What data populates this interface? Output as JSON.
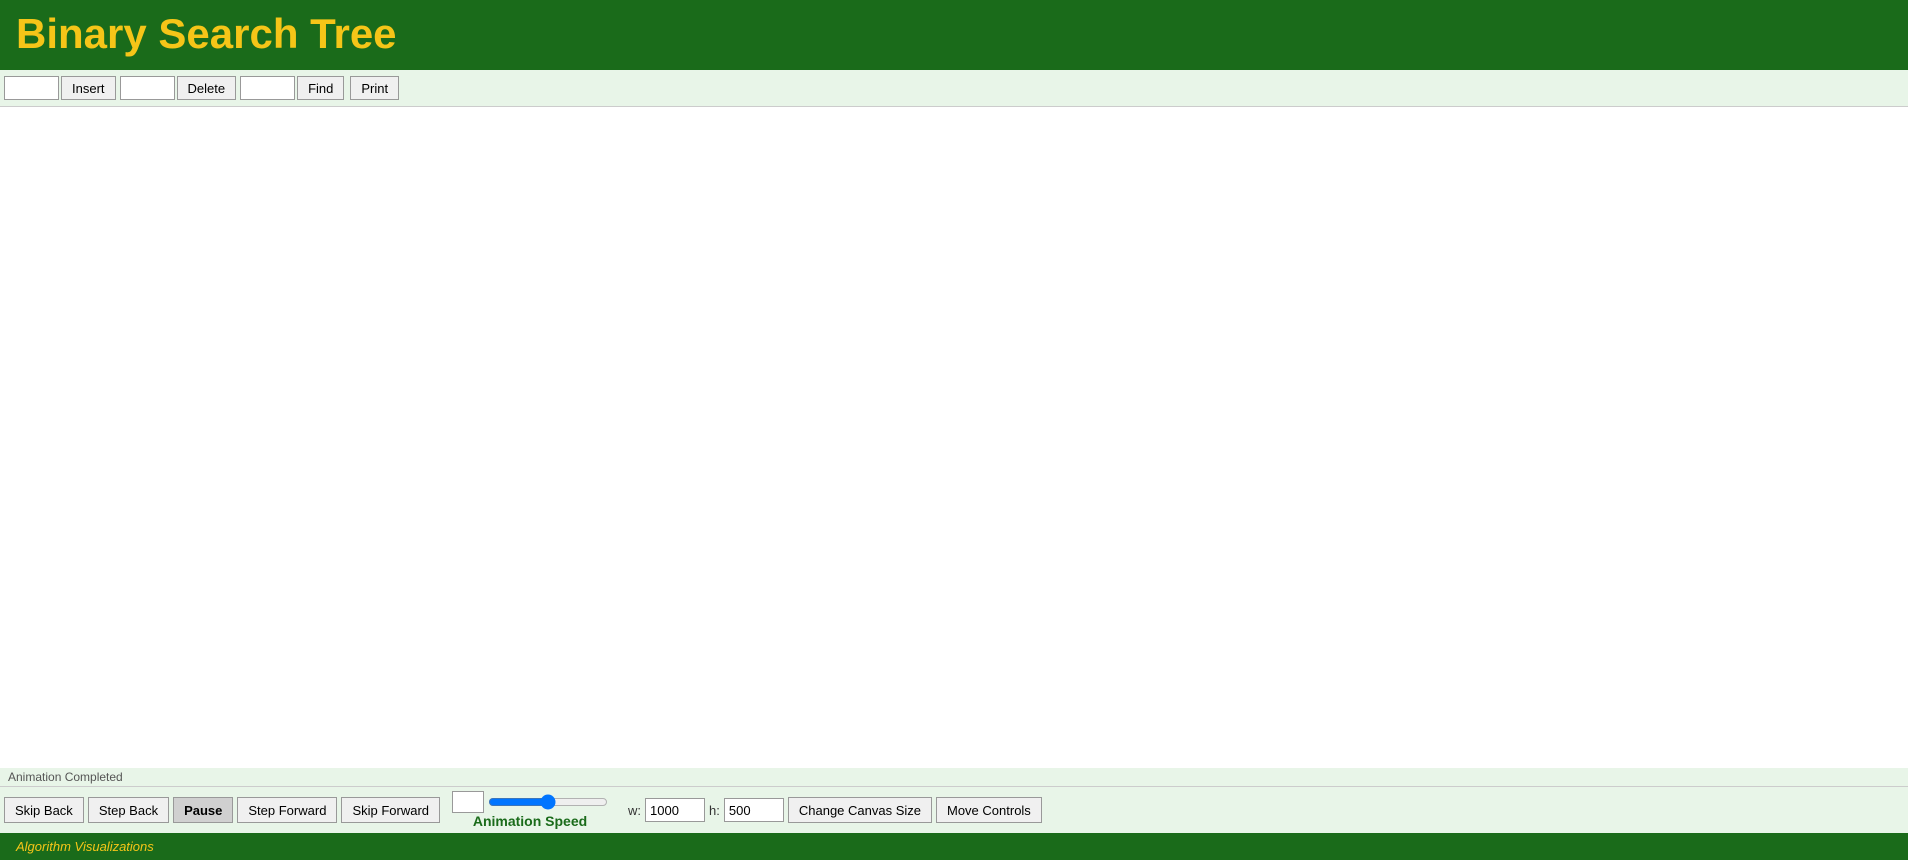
{
  "header": {
    "title": "Binary Search Tree",
    "background_color": "#1a6b1a",
    "title_color": "#f5c518"
  },
  "toolbar": {
    "insert_input_value": "",
    "insert_button_label": "Insert",
    "delete_input_value": "",
    "delete_button_label": "Delete",
    "find_input_value": "",
    "find_button_label": "Find",
    "print_button_label": "Print"
  },
  "canvas": {
    "background": "#ffffff"
  },
  "status": {
    "text": "Animation Completed"
  },
  "bottom_controls": {
    "skip_back_label": "Skip Back",
    "step_back_label": "Step Back",
    "pause_label": "Pause",
    "step_forward_label": "Step Forward",
    "skip_forward_label": "Skip Forward",
    "animation_speed_label": "Animation Speed",
    "width_label": "w:",
    "width_value": "1000",
    "height_label": "h:",
    "height_value": "500",
    "change_canvas_label": "Change Canvas Size",
    "move_controls_label": "Move Controls"
  },
  "footer": {
    "link_text": "Algorithm Visualizations"
  }
}
